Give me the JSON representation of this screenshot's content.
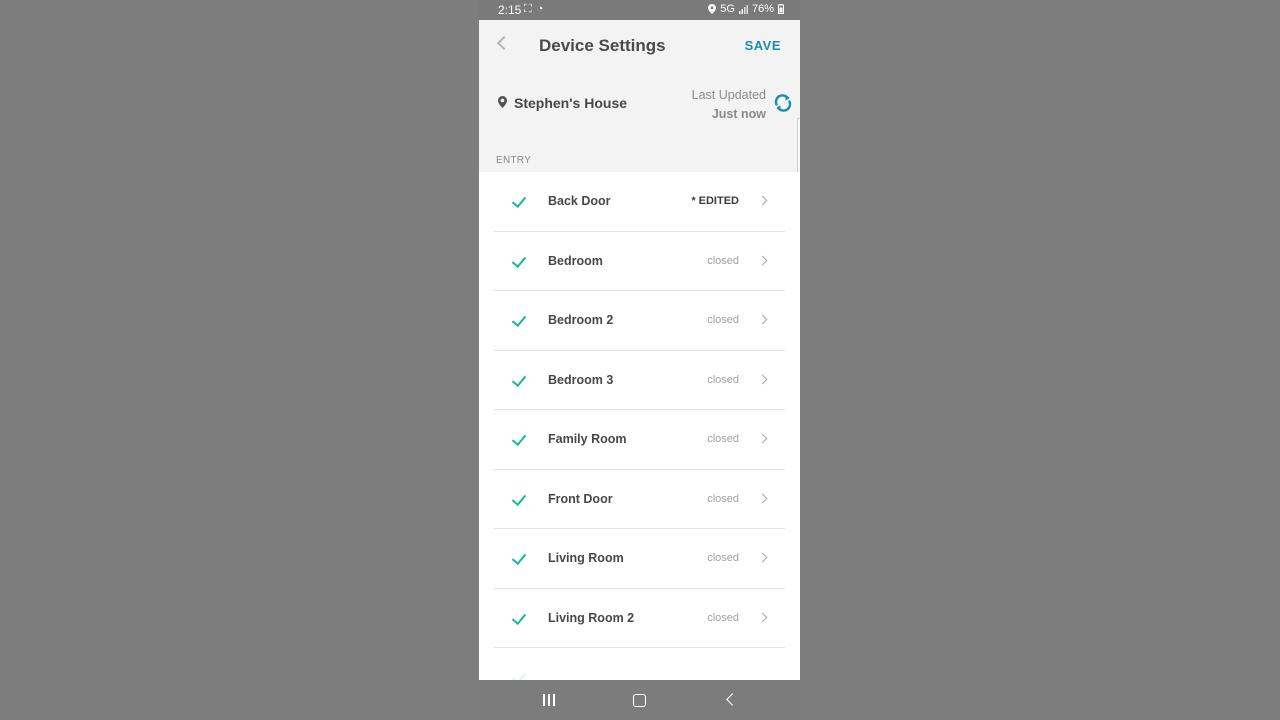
{
  "status_bar": {
    "time": "2:15",
    "left_icons": [
      "screenshot-icon",
      "notification-icon"
    ],
    "network": "5G",
    "battery": "76%"
  },
  "header": {
    "title": "Device Settings",
    "save_label": "SAVE"
  },
  "location": {
    "name": "Stephen's House",
    "last_updated_label": "Last Updated",
    "last_updated_value": "Just now"
  },
  "section": {
    "label": "ENTRY"
  },
  "devices": [
    {
      "label": "Back Door",
      "status": "* EDITED",
      "checked": true
    },
    {
      "label": "Bedroom",
      "status": "closed",
      "checked": true
    },
    {
      "label": "Bedroom 2",
      "status": "closed",
      "checked": true
    },
    {
      "label": "Bedroom 3",
      "status": "closed",
      "checked": true
    },
    {
      "label": "Family Room",
      "status": "closed",
      "checked": true
    },
    {
      "label": "Front Door",
      "status": "closed",
      "checked": true
    },
    {
      "label": "Living Room",
      "status": "closed",
      "checked": true
    },
    {
      "label": "Living Room 2",
      "status": "closed",
      "checked": true
    }
  ],
  "colors": {
    "accent": "#1a8fa8",
    "check": "#19b5a1",
    "background": "#f3f3f3",
    "outer_background": "#7d7d7d"
  }
}
